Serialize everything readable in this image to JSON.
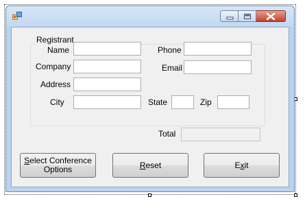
{
  "window": {
    "title": "",
    "icon": "form-icon",
    "caption_buttons": [
      "minimize-icon",
      "maximize-icon",
      "close-icon"
    ]
  },
  "group": {
    "title": "Registrant"
  },
  "labels": {
    "name": "Name",
    "company": "Company",
    "address": "Address",
    "city": "City",
    "phone": "Phone",
    "email": "Email",
    "state": "State",
    "zip": "Zip",
    "total": "Total"
  },
  "fields": {
    "name": "",
    "company": "",
    "address": "",
    "city": "",
    "phone": "",
    "email": "",
    "state": "",
    "zip": "",
    "total": ""
  },
  "buttons": {
    "select_conference": {
      "mnemonic": "S",
      "rest": "elect Conference",
      "line2": "Options"
    },
    "reset": {
      "mnemonic": "R",
      "rest": "eset"
    },
    "exit": {
      "pre": "E",
      "mnemonic": "x",
      "rest": "it"
    }
  },
  "colors": {
    "window_frame": "#bcd3ee",
    "client_background": "#f0f0f0",
    "close_button": "#c5432b"
  }
}
